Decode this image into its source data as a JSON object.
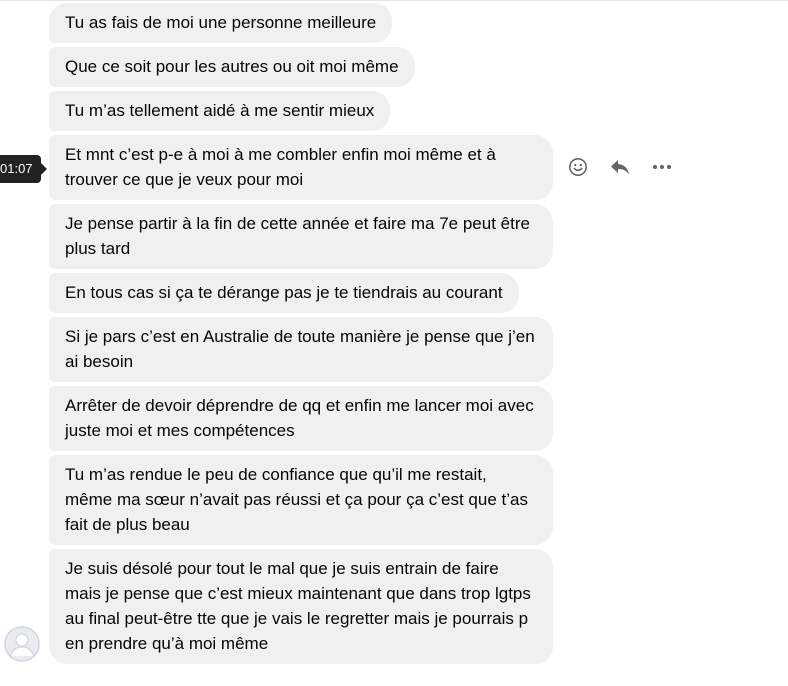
{
  "timestamp": "01:07",
  "actions": {
    "react_icon": "smiley-icon",
    "reply_icon": "reply-icon",
    "more_icon": "more-horizontal-icon"
  },
  "avatar_icon": "default-avatar-icon",
  "messages": [
    "Tu as fais de moi une personne meilleure",
    "Que ce soit pour les autres ou oit moi même",
    "Tu  m’as tellement aidé à me sentir mieux",
    "Et mnt c’est p-e à moi à me combler enfin moi même et à trouver ce que je veux pour moi",
    "Je pense partir à la fin de cette année et faire ma 7e peut être plus tard",
    "En tous cas si ça te dérange pas je te tiendrais au courant",
    "Si je pars c’est en Australie de toute manière je pense que j’en ai besoin",
    "Arrêter de devoir déprendre de qq et enfin me lancer moi avec juste moi et mes compétences",
    "Tu m’as rendue le peu de confiance que qu’il me restait, même ma sœur n’avait pas réussi et ça pour ça c’est que t’as fait de plus beau",
    "Je suis désolé pour tout le mal que je suis entrain de faire mais je pense que c’est mieux maintenant que dans trop lgtps au final peut-être tte que je vais le regretter mais je pourrais p en prendre qu’à moi même"
  ],
  "colors": {
    "bubble": "#f0f0f0",
    "text": "#050505",
    "icon": "#65676b",
    "tooltip": "#222222"
  }
}
